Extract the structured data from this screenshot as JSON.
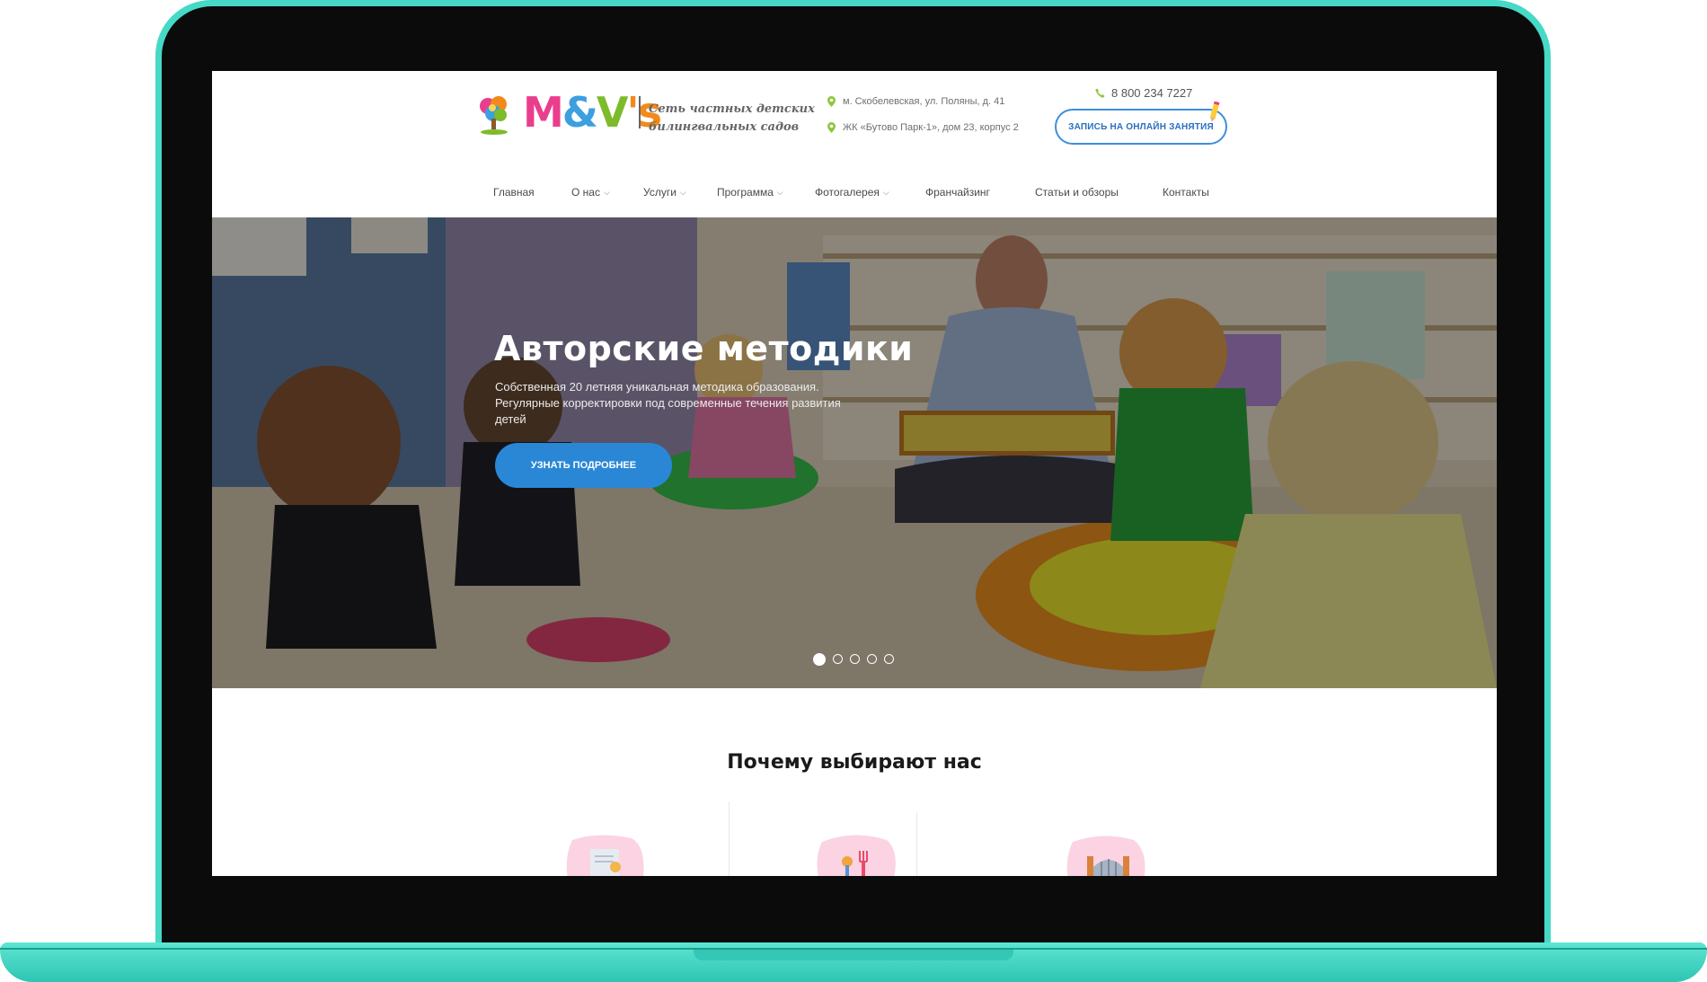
{
  "header": {
    "logo_text": "M&V's",
    "tagline_line1": "Сеть частных детских",
    "tagline_line2": "билингвальных садов",
    "address1": "м. Скобелевская, ул. Поляны, д. 41",
    "address2": "ЖК «Бутово Парк-1», дом 23, корпус 2",
    "phone": "8 800 234 7227",
    "cta_label": "Запись на онлайн занятия"
  },
  "nav": {
    "items": [
      {
        "label": "Главная",
        "has_dropdown": false
      },
      {
        "label": "О нас",
        "has_dropdown": true
      },
      {
        "label": "Услуги",
        "has_dropdown": true
      },
      {
        "label": "Программа",
        "has_dropdown": true
      },
      {
        "label": "Фотогалерея",
        "has_dropdown": true
      },
      {
        "label": "Франчайзинг",
        "has_dropdown": false
      },
      {
        "label": "Статьи и обзоры",
        "has_dropdown": false
      },
      {
        "label": "Контакты",
        "has_dropdown": false
      }
    ],
    "dropdown_glyph": "⌵"
  },
  "hero": {
    "title": "Авторские методики",
    "desc_line1": "Собственная 20 летняя уникальная методика образования.",
    "desc_line2": "Регулярные корректировки под современные течения развития",
    "desc_line3": "детей",
    "button_label": "Узнать подробнее",
    "slides_count": 5,
    "active_slide": 1
  },
  "why": {
    "title": "Почему выбирают нас"
  },
  "colors": {
    "frame": "#45d9c6",
    "accent_blue": "#2a87d6",
    "pin_green": "#8dc63f",
    "logo_pink": "#ea3e8d"
  },
  "icons": [
    "logo-tree-icon",
    "location-pin-icon",
    "phone-icon",
    "pencil-icon",
    "chevron-down-icon",
    "certificate-icon",
    "cutlery-icon",
    "gate-icon"
  ]
}
